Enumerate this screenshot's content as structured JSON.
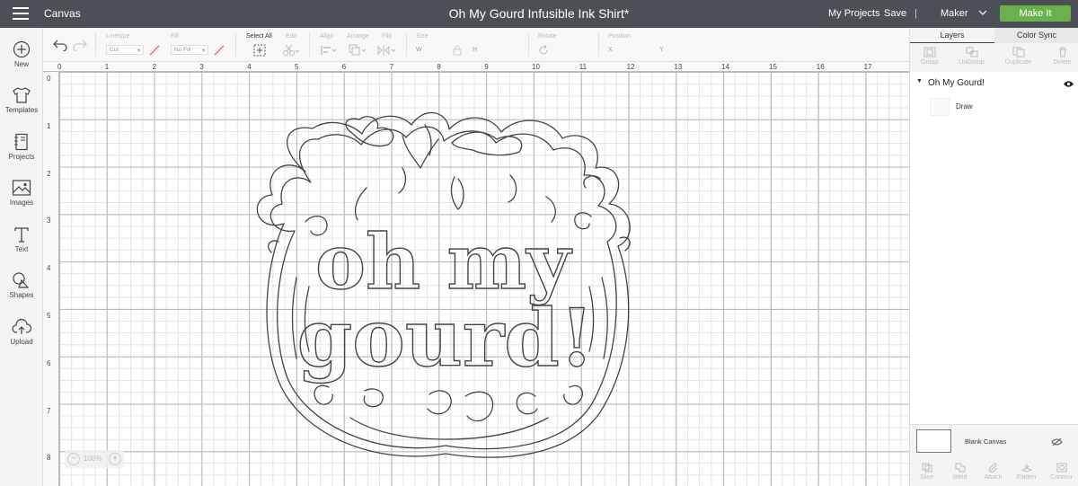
{
  "topbar": {
    "app_name": "Canvas",
    "doc_title": "Oh My Gourd Infusible Ink Shirt*",
    "my_projects": "My Projects",
    "save": "Save",
    "separator": "|",
    "machine": "Maker",
    "make_it": "Make It"
  },
  "sidebar": {
    "items": [
      {
        "label": "New",
        "icon": "plus-circle-icon"
      },
      {
        "label": "Templates",
        "icon": "shirt-icon"
      },
      {
        "label": "Projects",
        "icon": "notebook-icon"
      },
      {
        "label": "Images",
        "icon": "image-icon"
      },
      {
        "label": "Text",
        "icon": "text-icon"
      },
      {
        "label": "Shapes",
        "icon": "shapes-icon"
      },
      {
        "label": "Upload",
        "icon": "cloud-upload-icon"
      }
    ]
  },
  "toolbar": {
    "linetype_label": "Linetype",
    "linetype_value": "Cut",
    "fill_label": "Fill",
    "fill_value": "No Fill",
    "select_all": "Select All",
    "edit": "Edit",
    "align": "Align",
    "arrange": "Arrange",
    "flip": "Flip",
    "size": "Size",
    "width_label": "W",
    "height_label": "H",
    "rotate": "Rotate",
    "position": "Position",
    "x_label": "X",
    "y_label": "Y"
  },
  "ruler": {
    "h": [
      "0",
      "1",
      "2",
      "3",
      "4",
      "5",
      "6",
      "7",
      "8",
      "9",
      "10",
      "11",
      "12",
      "13",
      "14",
      "15",
      "16",
      "17"
    ],
    "v": [
      "0",
      "1",
      "2",
      "3",
      "4",
      "5",
      "6",
      "7",
      "8"
    ]
  },
  "canvas": {
    "zoom": "100%",
    "zoom_out": "−",
    "zoom_in": "+",
    "design_line1": "oh my",
    "design_line2": "gourd!"
  },
  "panel": {
    "tabs": [
      "Layers",
      "Color Sync"
    ],
    "tools": [
      "Group",
      "UnGroup",
      "Duplicate",
      "Delete"
    ],
    "group_name": "Oh My Gourd!",
    "layer_name": "Draw",
    "blank_canvas": "Blank Canvas",
    "bottom_tools": [
      "Slice",
      "Weld",
      "Attach",
      "Flatten",
      "Contour"
    ]
  },
  "colors": {
    "topbar": "#4b5056",
    "make_it": "#6ab04c",
    "disabled": "#bbbbbb",
    "accent_red": "#e57373"
  }
}
